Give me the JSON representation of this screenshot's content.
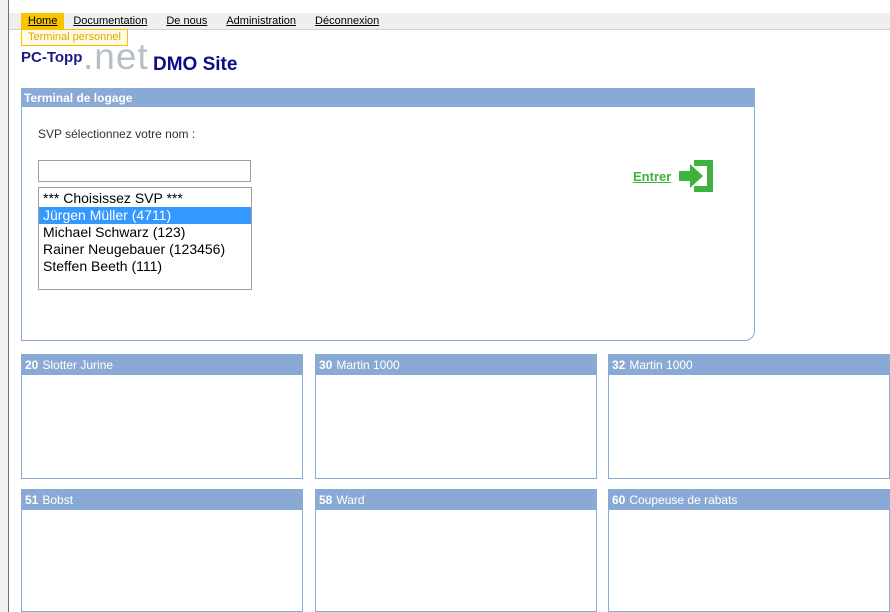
{
  "nav": {
    "items": [
      {
        "label": "Home",
        "active": true
      },
      {
        "label": "Documentation"
      },
      {
        "label": "De nous"
      },
      {
        "label": "Administration"
      },
      {
        "label": "Déconnexion"
      }
    ],
    "subtab": "Terminal personnel"
  },
  "logo": {
    "pc": "PC-Topp",
    "net": ".net",
    "site": "DMO Site"
  },
  "login_panel": {
    "title": "Terminal de logage",
    "prompt": "SVP sélectionnez votre nom :",
    "search_value": "",
    "names": [
      "*** Choisissez SVP ***",
      "Jürgen Müller (4711)",
      "Michael Schwarz (123)",
      "Rainer Neugebauer (123456)",
      "Steffen Beeth (111)"
    ],
    "selected_index": 1,
    "enter_label": "Entrer",
    "enter_icon": "enter-arrow-icon"
  },
  "machines": [
    {
      "number": "20",
      "name": "Slotter Jurine"
    },
    {
      "number": "30",
      "name": "Martin 1000"
    },
    {
      "number": "32",
      "name": "Martin 1000"
    },
    {
      "number": "51",
      "name": "Bobst"
    },
    {
      "number": "58",
      "name": "Ward"
    },
    {
      "number": "60",
      "name": "Coupeuse de rabats"
    }
  ],
  "colors": {
    "nav_active": "#f8c400",
    "panel_header": "#8aaad6",
    "enter_green": "#3db33d",
    "selection": "#3399ff",
    "logo_blue": "#0b0b8c"
  }
}
